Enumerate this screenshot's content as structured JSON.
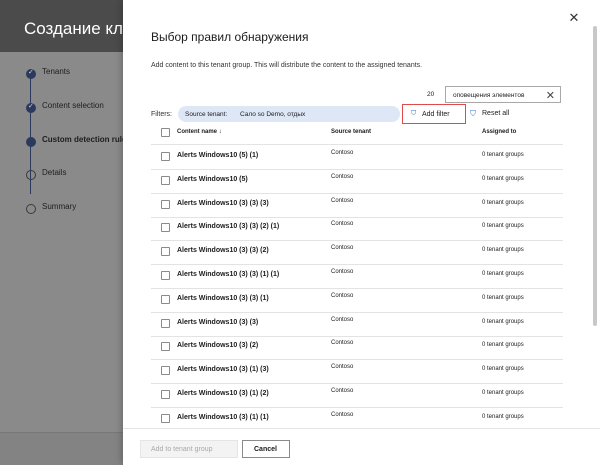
{
  "background": {
    "title": "Создание клие",
    "steps": [
      {
        "label": "Tenants",
        "state": "done"
      },
      {
        "label": "Content selection",
        "state": "done"
      },
      {
        "label": "Custom detection rule",
        "state": "current"
      },
      {
        "label": "Details",
        "state": "todo"
      },
      {
        "label": "Summary",
        "state": "todo"
      }
    ]
  },
  "panel": {
    "title": "Выбор правил обнаружения",
    "description": "Add content to this tenant group. This will distribute the content to the assigned tenants.",
    "count_prefix": "20",
    "search_value": "оповещения элементов",
    "filters_label": "Filters:",
    "chip_key": "Source tenant:",
    "chip_value": "Сало so Demo, отдых",
    "add_filter_label": "Add filter",
    "reset_all_label": "Reset all",
    "columns": {
      "name": "Content name ↓",
      "source": "Source tenant",
      "assigned": "Assigned to"
    },
    "rows": [
      {
        "name": "Alerts Windows10 (5) (1)",
        "source": "Contoso",
        "assigned": "0 tenant groups"
      },
      {
        "name": "Alerts Windows10 (5)",
        "source": "Contoso",
        "assigned": "0 tenant groups"
      },
      {
        "name": "Alerts Windows10 (3) (3) (3)",
        "source": "Contoso",
        "assigned": "0 tenant groups"
      },
      {
        "name": "Alerts Windows10 (3) (3) (2) (1)",
        "source": "Contoso",
        "assigned": "0 tenant groups"
      },
      {
        "name": "Alerts Windows10 (3) (3) (2)",
        "source": "Contoso",
        "assigned": "0 tenant groups"
      },
      {
        "name": "Alerts Windows10 (3) (3) (1) (1)",
        "source": "Contoso",
        "assigned": "0 tenant groups"
      },
      {
        "name": "Alerts Windows10 (3) (3) (1)",
        "source": "Contoso",
        "assigned": "0 tenant groups"
      },
      {
        "name": "Alerts Windows10 (3) (3)",
        "source": "Contoso",
        "assigned": "0 tenant groups"
      },
      {
        "name": "Alerts Windows10 (3) (2)",
        "source": "Contoso",
        "assigned": "0 tenant groups"
      },
      {
        "name": "Alerts Windows10 (3) (1) (3)",
        "source": "Contoso",
        "assigned": "0 tenant groups"
      },
      {
        "name": "Alerts Windows10 (3) (1) (2)",
        "source": "Contoso",
        "assigned": "0 tenant groups"
      },
      {
        "name": "Alerts Windows10 (3) (1) (1)",
        "source": "Contoso",
        "assigned": "0 tenant groups"
      }
    ],
    "add_button_label": "Add to tenant group",
    "cancel_button_label": "Cancel"
  },
  "icons": {
    "close": "close-icon",
    "filter": "filter-icon",
    "reset": "filter-reset-icon",
    "check": "check-icon"
  },
  "colors": {
    "accent": "#2b3a5c",
    "chip_bg": "#dde7f6",
    "highlight": "#e14a4a",
    "link_icon": "#3a6fc4"
  }
}
